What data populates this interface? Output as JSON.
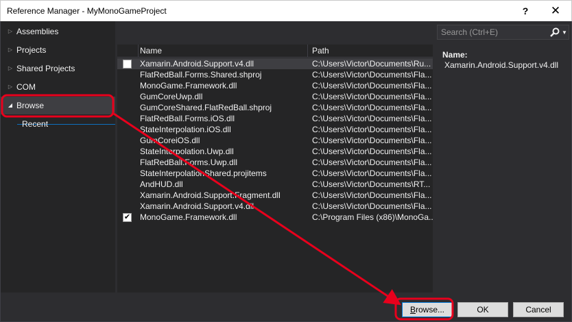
{
  "window": {
    "title": "Reference Manager - MyMonoGameProject",
    "help_label": "?",
    "close_label": "✕"
  },
  "sidebar": {
    "items": [
      {
        "label": "Assemblies",
        "expanded": false
      },
      {
        "label": "Projects",
        "expanded": false
      },
      {
        "label": "Shared Projects",
        "expanded": false
      },
      {
        "label": "COM",
        "expanded": false
      },
      {
        "label": "Browse",
        "expanded": true,
        "selected": true
      }
    ],
    "sub_item": "Recent"
  },
  "list": {
    "columns": [
      "Name",
      "Path"
    ],
    "rows": [
      {
        "name": "Xamarin.Android.Support.v4.dll",
        "path": "C:\\Users\\Victor\\Documents\\Ru...",
        "checked": false,
        "has_checkbox": true
      },
      {
        "name": "FlatRedBall.Forms.Shared.shproj",
        "path": "C:\\Users\\Victor\\Documents\\Fla...",
        "checked": false,
        "has_checkbox": false
      },
      {
        "name": "MonoGame.Framework.dll",
        "path": "C:\\Users\\Victor\\Documents\\Fla...",
        "checked": false,
        "has_checkbox": false
      },
      {
        "name": "GumCoreUwp.dll",
        "path": "C:\\Users\\Victor\\Documents\\Fla...",
        "checked": false,
        "has_checkbox": false
      },
      {
        "name": "GumCoreShared.FlatRedBall.shproj",
        "path": "C:\\Users\\Victor\\Documents\\Fla...",
        "checked": false,
        "has_checkbox": false
      },
      {
        "name": "FlatRedBall.Forms.iOS.dll",
        "path": "C:\\Users\\Victor\\Documents\\Fla...",
        "checked": false,
        "has_checkbox": false
      },
      {
        "name": "StateInterpolation.iOS.dll",
        "path": "C:\\Users\\Victor\\Documents\\Fla...",
        "checked": false,
        "has_checkbox": false
      },
      {
        "name": "GumCoreiOS.dll",
        "path": "C:\\Users\\Victor\\Documents\\Fla...",
        "checked": false,
        "has_checkbox": false
      },
      {
        "name": "StateInterpolation.Uwp.dll",
        "path": "C:\\Users\\Victor\\Documents\\Fla...",
        "checked": false,
        "has_checkbox": false
      },
      {
        "name": "FlatRedBall.Forms.Uwp.dll",
        "path": "C:\\Users\\Victor\\Documents\\Fla...",
        "checked": false,
        "has_checkbox": false
      },
      {
        "name": "StateInterpolationShared.projitems",
        "path": "C:\\Users\\Victor\\Documents\\Fla...",
        "checked": false,
        "has_checkbox": false
      },
      {
        "name": "AndHUD.dll",
        "path": "C:\\Users\\Victor\\Documents\\RT...",
        "checked": false,
        "has_checkbox": false
      },
      {
        "name": "Xamarin.Android.Support.Fragment.dll",
        "path": "C:\\Users\\Victor\\Documents\\Fla...",
        "checked": false,
        "has_checkbox": false
      },
      {
        "name": "Xamarin.Android.Support.v4.dll",
        "path": "C:\\Users\\Victor\\Documents\\Fla...",
        "checked": false,
        "has_checkbox": false
      },
      {
        "name": "MonoGame.Framework.dll",
        "path": "C:\\Program Files (x86)\\MonoGa...",
        "checked": true,
        "has_checkbox": true
      }
    ]
  },
  "search": {
    "placeholder": "Search (Ctrl+E)",
    "icon": "search-icon"
  },
  "details": {
    "label": "Name:",
    "value": "Xamarin.Android.Support.v4.dll"
  },
  "buttons": {
    "browse": "Browse...",
    "ok": "OK",
    "cancel": "Cancel"
  },
  "colors": {
    "background": "#2d2d30",
    "panel": "#252526",
    "selection": "#3e3e42",
    "annotation": "#e8001c"
  }
}
